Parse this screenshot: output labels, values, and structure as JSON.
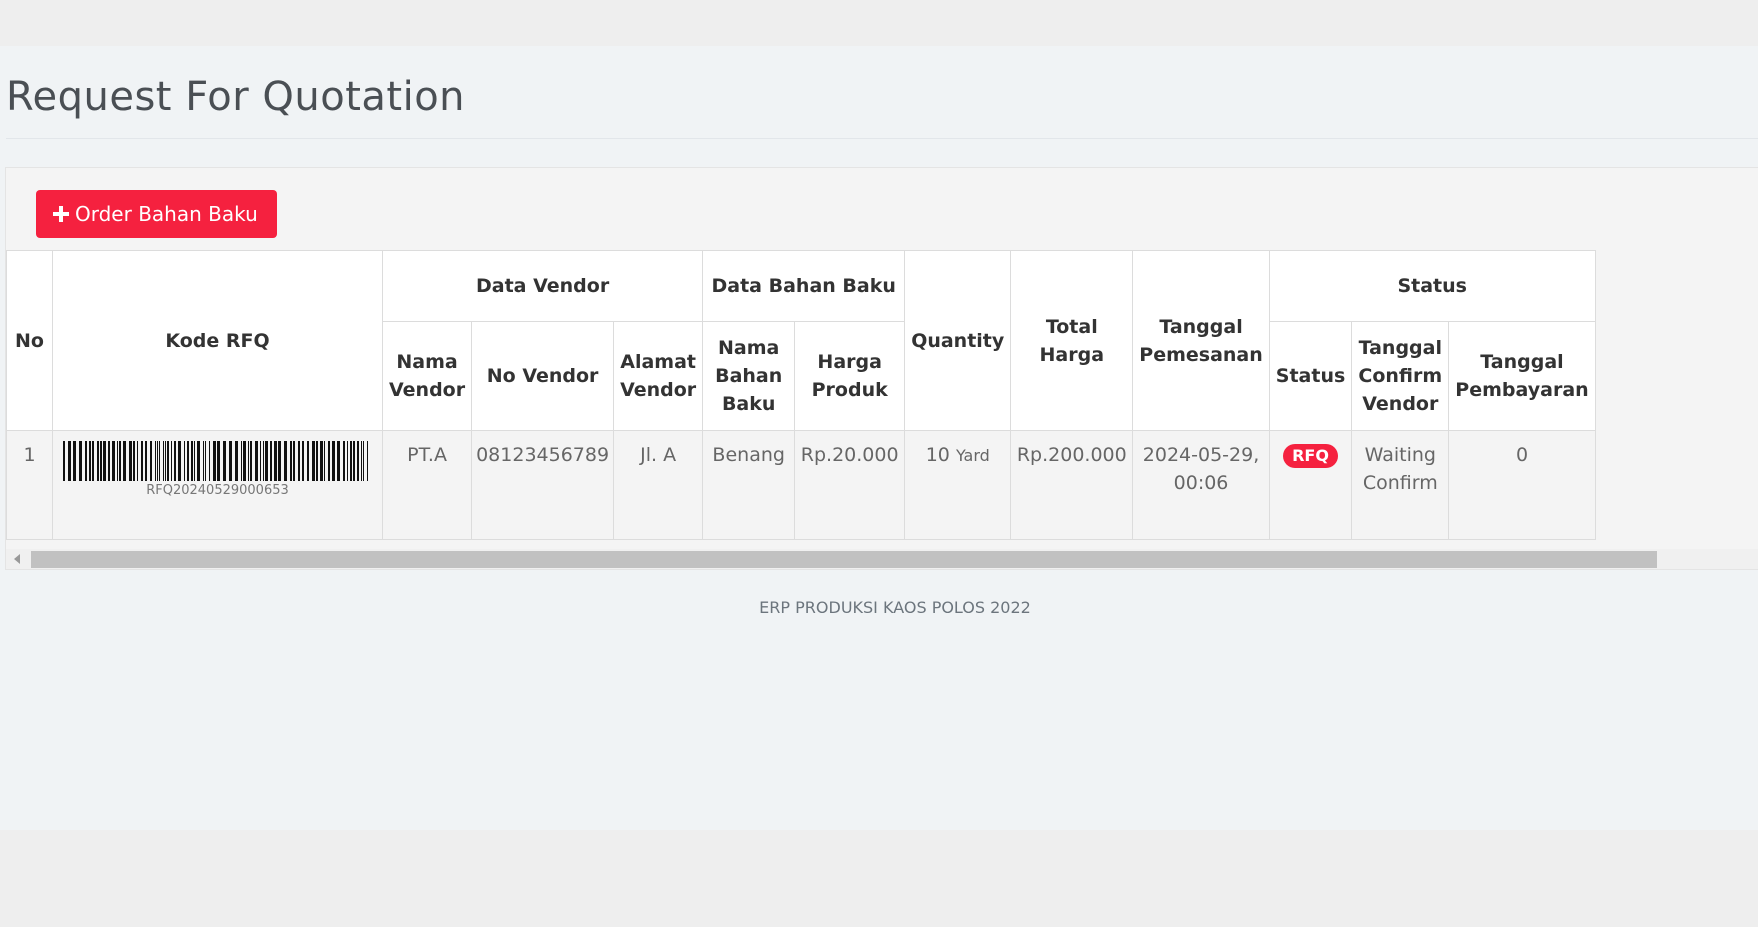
{
  "page": {
    "title": "Request For Quotation"
  },
  "toolbar": {
    "order_label": "Order Bahan Baku",
    "order_icon": "plus-icon",
    "accent": "#f5213f"
  },
  "table": {
    "groups": {
      "no": "No",
      "kode": "Kode RFQ",
      "vendor": "Data Vendor",
      "bahan": "Data Bahan Baku",
      "quantity": "Quantity",
      "total": "Total Harga",
      "tanggal": "Tanggal Pemesanan",
      "status": "Status"
    },
    "subheaders": {
      "nama_vendor": "Nama Vendor",
      "no_vendor": "No Vendor",
      "alamat_vendor": "Alamat Vendor",
      "nama_bahan": "Nama Bahan Baku",
      "harga_produk": "Harga Produk",
      "status": "Status",
      "tgl_confirm": "Tanggal Confirm Vendor",
      "tgl_bayar": "Tanggal Pembayaran"
    },
    "rows": [
      {
        "no": "1",
        "kode": "RFQ20240529000653",
        "nama_vendor": "PT.A",
        "no_vendor": "08123456789",
        "alamat_vendor": "Jl. A",
        "nama_bahan": "Benang",
        "harga_produk": "Rp.20.000",
        "qty": "10",
        "unit": "Yard",
        "total": "Rp.200.000",
        "tanggal": "2024-05-29, 00:06",
        "status": "RFQ",
        "tgl_confirm": "Waiting Confirm",
        "tgl_bayar": "0"
      }
    ]
  },
  "footer": {
    "text": "ERP PRODUKSI KAOS POLOS 2022"
  }
}
